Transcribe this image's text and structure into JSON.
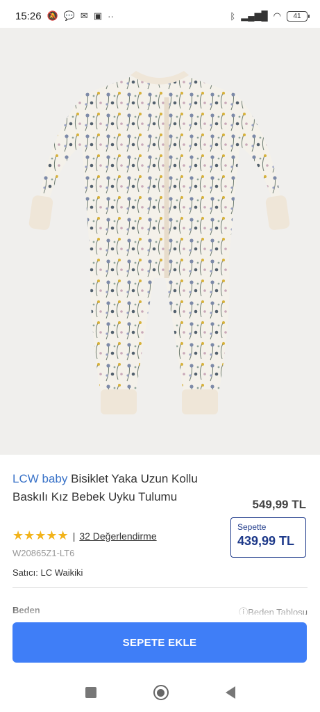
{
  "status_bar": {
    "time": "15:26",
    "notification_icons": [
      "muted-bell-icon",
      "chat-icon",
      "mail-icon",
      "app-icon",
      "more-dots-icon"
    ],
    "right_icons": [
      "bluetooth-icon",
      "signal-icon",
      "wifi-icon"
    ],
    "battery": "41"
  },
  "product": {
    "image_alt": "floral print baby sleepsuit",
    "brand": "LCW baby",
    "name": "Bisiklet Yaka Uzun Kollu Baskılı Kız Bebek Uyku Tulumu",
    "price": "549,99 TL",
    "basket_label": "Sepette",
    "basket_price": "439,99 TL",
    "rating": 4.5,
    "stars": "★★★★★",
    "reviews": "32 Değerlendirme",
    "reviews_separator": "|",
    "sku": "W20865Z1-LT6",
    "seller_label": "Satıcı:",
    "seller_name": "LC Waikiki",
    "size_label": "Beden",
    "size_table": "Beden Tablosu"
  },
  "actions": {
    "add_to_cart": "SEPETE EKLE"
  },
  "colors": {
    "brand": "#3a73c8",
    "primary_button": "#3f7ef7",
    "basket_box": "#1e3a8a",
    "stars": "#f2b31a"
  }
}
